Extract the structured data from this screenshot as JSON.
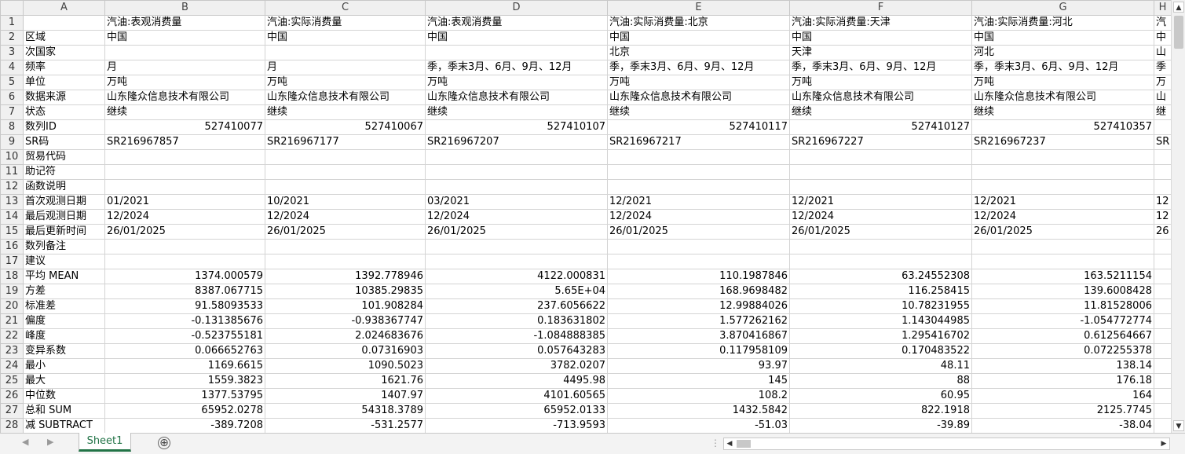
{
  "columns": [
    "A",
    "B",
    "C",
    "D",
    "E",
    "F",
    "G",
    "H"
  ],
  "rows": [
    {
      "n": "1",
      "a": "",
      "b": "汽油:表观消费量",
      "c": "汽油:实际消费量",
      "d": "汽油:表观消费量",
      "e": "汽油:实际消费量:北京",
      "f": "汽油:实际消费量:天津",
      "g": "汽油:实际消费量:河北",
      "h": "汽"
    },
    {
      "n": "2",
      "a": "区域",
      "b": "中国",
      "c": "中国",
      "d": "中国",
      "e": "中国",
      "f": "中国",
      "g": "中国",
      "h": "中"
    },
    {
      "n": "3",
      "a": "次国家",
      "b": "",
      "c": "",
      "d": "",
      "e": "北京",
      "f": "天津",
      "g": "河北",
      "h": "山"
    },
    {
      "n": "4",
      "a": "频率",
      "b": "月",
      "c": "月",
      "d": "季，季末3月、6月、9月、12月",
      "e": "季，季末3月、6月、9月、12月",
      "f": "季，季末3月、6月、9月、12月",
      "g": "季，季末3月、6月、9月、12月",
      "h": "季"
    },
    {
      "n": "5",
      "a": "单位",
      "b": "万吨",
      "c": "万吨",
      "d": "万吨",
      "e": "万吨",
      "f": "万吨",
      "g": "万吨",
      "h": "万"
    },
    {
      "n": "6",
      "a": "数据来源",
      "b": "山东隆众信息技术有限公司",
      "c": "山东隆众信息技术有限公司",
      "d": "山东隆众信息技术有限公司",
      "e": "山东隆众信息技术有限公司",
      "f": "山东隆众信息技术有限公司",
      "g": "山东隆众信息技术有限公司",
      "h": "山"
    },
    {
      "n": "7",
      "a": "状态",
      "b": "继续",
      "c": "继续",
      "d": "继续",
      "e": "继续",
      "f": "继续",
      "g": "继续",
      "h": "继"
    },
    {
      "n": "8",
      "a": "数列ID",
      "b": "527410077",
      "c": "527410067",
      "d": "527410107",
      "e": "527410117",
      "f": "527410127",
      "g": "527410357",
      "h": "",
      "num": true
    },
    {
      "n": "9",
      "a": "SR码",
      "b": "SR216967857",
      "c": "SR216967177",
      "d": "SR216967207",
      "e": "SR216967217",
      "f": "SR216967227",
      "g": "SR216967237",
      "h": "SR"
    },
    {
      "n": "10",
      "a": "贸易代码",
      "b": "",
      "c": "",
      "d": "",
      "e": "",
      "f": "",
      "g": "",
      "h": ""
    },
    {
      "n": "11",
      "a": "助记符",
      "b": "",
      "c": "",
      "d": "",
      "e": "",
      "f": "",
      "g": "",
      "h": ""
    },
    {
      "n": "12",
      "a": "函数说明",
      "b": "",
      "c": "",
      "d": "",
      "e": "",
      "f": "",
      "g": "",
      "h": ""
    },
    {
      "n": "13",
      "a": "首次观测日期",
      "b": "01/2021",
      "c": "10/2021",
      "d": "03/2021",
      "e": "12/2021",
      "f": "12/2021",
      "g": "12/2021",
      "h": "12"
    },
    {
      "n": "14",
      "a": "最后观测日期",
      "b": "12/2024",
      "c": "12/2024",
      "d": "12/2024",
      "e": "12/2024",
      "f": "12/2024",
      "g": "12/2024",
      "h": "12"
    },
    {
      "n": "15",
      "a": "最后更新时间",
      "b": "26/01/2025",
      "c": "26/01/2025",
      "d": "26/01/2025",
      "e": "26/01/2025",
      "f": "26/01/2025",
      "g": "26/01/2025",
      "h": "26"
    },
    {
      "n": "16",
      "a": "数列备注",
      "b": "",
      "c": "",
      "d": "",
      "e": "",
      "f": "",
      "g": "",
      "h": ""
    },
    {
      "n": "17",
      "a": "建议",
      "b": "",
      "c": "",
      "d": "",
      "e": "",
      "f": "",
      "g": "",
      "h": ""
    },
    {
      "n": "18",
      "a": "平均 MEAN",
      "b": "1374.000579",
      "c": "1392.778946",
      "d": "4122.000831",
      "e": "110.1987846",
      "f": "63.24552308",
      "g": "163.5211154",
      "h": "",
      "num": true
    },
    {
      "n": "19",
      "a": "方差",
      "b": "8387.067715",
      "c": "10385.29835",
      "d": "5.65E+04",
      "e": "168.9698482",
      "f": "116.258415",
      "g": "139.6008428",
      "h": "",
      "num": true
    },
    {
      "n": "20",
      "a": "标准差",
      "b": "91.58093533",
      "c": "101.908284",
      "d": "237.6056622",
      "e": "12.99884026",
      "f": "10.78231955",
      "g": "11.81528006",
      "h": "",
      "num": true
    },
    {
      "n": "21",
      "a": "偏度",
      "b": "-0.131385676",
      "c": "-0.938367747",
      "d": "0.183631802",
      "e": "1.577262162",
      "f": "1.143044985",
      "g": "-1.054772774",
      "h": "",
      "num": true
    },
    {
      "n": "22",
      "a": "峰度",
      "b": "-0.523755181",
      "c": "2.024683676",
      "d": "-1.084888385",
      "e": "3.870416867",
      "f": "1.295416702",
      "g": "0.612564667",
      "h": "",
      "num": true
    },
    {
      "n": "23",
      "a": "变异系数",
      "b": "0.066652763",
      "c": "0.07316903",
      "d": "0.057643283",
      "e": "0.117958109",
      "f": "0.170483522",
      "g": "0.072255378",
      "h": "",
      "num": true
    },
    {
      "n": "24",
      "a": "最小",
      "b": "1169.6615",
      "c": "1090.5023",
      "d": "3782.0207",
      "e": "93.97",
      "f": "48.11",
      "g": "138.14",
      "h": "",
      "num": true
    },
    {
      "n": "25",
      "a": "最大",
      "b": "1559.3823",
      "c": "1621.76",
      "d": "4495.98",
      "e": "145",
      "f": "88",
      "g": "176.18",
      "h": "",
      "num": true
    },
    {
      "n": "26",
      "a": "中位数",
      "b": "1377.53795",
      "c": "1407.97",
      "d": "4101.60565",
      "e": "108.2",
      "f": "60.95",
      "g": "164",
      "h": "",
      "num": true
    },
    {
      "n": "27",
      "a": "总和 SUM",
      "b": "65952.0278",
      "c": "54318.3789",
      "d": "65952.0133",
      "e": "1432.5842",
      "f": "822.1918",
      "g": "2125.7745",
      "h": "",
      "num": true
    },
    {
      "n": "28",
      "a": "减 SUBTRACT",
      "b": "-389.7208",
      "c": "-531.2577",
      "d": "-713.9593",
      "e": "-51.03",
      "f": "-39.89",
      "g": "-38.04",
      "h": "",
      "num": true
    }
  ],
  "sheet_tab": "Sheet1",
  "add_sheet_glyph": "⊕",
  "scroll_dots": "⋮",
  "colors": {
    "accent": "#217346",
    "grid": "#d4d4d4",
    "header_bg": "#f0f0f0"
  }
}
